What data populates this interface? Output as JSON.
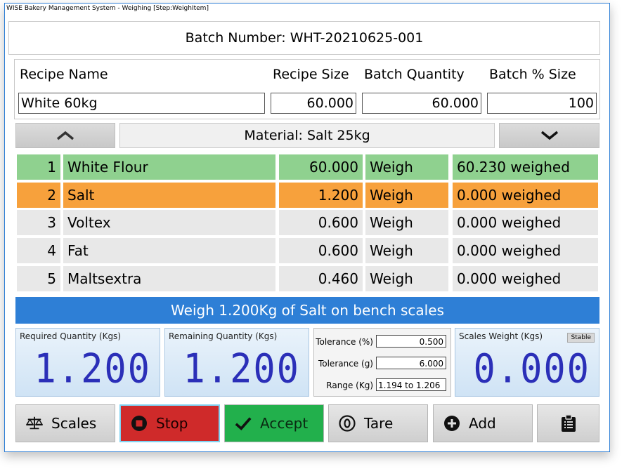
{
  "window": {
    "title": "WISE Bakery Management System - Weighing [Step:WeighItem]"
  },
  "batch": {
    "label": "Batch Number: WHT-20210625-001"
  },
  "recipe": {
    "name_label": "Recipe Name",
    "size_label": "Recipe Size",
    "quantity_label": "Batch Quantity",
    "percent_label": "Batch %  Size",
    "name_value": "White 60kg",
    "size_value": "60.000",
    "quantity_value": "60.000",
    "percent_value": "100"
  },
  "material": {
    "label": "Material: Salt 25kg"
  },
  "items": [
    {
      "num": "1",
      "name": "White Flour",
      "qty": "60.000",
      "action": "Weigh",
      "status": "60.230 weighed"
    },
    {
      "num": "2",
      "name": "Salt",
      "qty": "1.200",
      "action": "Weigh",
      "status": "0.000 weighed"
    },
    {
      "num": "3",
      "name": "Voltex",
      "qty": "0.600",
      "action": "Weigh",
      "status": "0.000 weighed"
    },
    {
      "num": "4",
      "name": "Fat",
      "qty": "0.600",
      "action": "Weigh",
      "status": "0.000 weighed"
    },
    {
      "num": "5",
      "name": "Maltsextra",
      "qty": "0.460",
      "action": "Weigh",
      "status": "0.000 weighed"
    }
  ],
  "instruction": "Weigh 1.200Kg of Salt on bench scales",
  "required": {
    "label": "Required Quantity (Kgs)",
    "value": "1.200"
  },
  "remaining": {
    "label": "Remaining Quantity (Kgs)",
    "value": "1.200"
  },
  "tolerance": {
    "pct_label": "Tolerance (%)",
    "pct_value": "0.500",
    "g_label": "Tolerance (g)",
    "g_value": "6.000",
    "range_label": "Range (Kg)",
    "range_value": "1.194 to 1.206"
  },
  "scales": {
    "label": "Scales Weight (Kgs)",
    "value": "0.000",
    "status": "Stable"
  },
  "buttons": {
    "scales": "Scales",
    "stop": "Stop",
    "accept": "Accept",
    "tare": "Tare",
    "add": "Add"
  },
  "colors": {
    "accent": "#2e7fd6",
    "done": "#8fd18f",
    "current": "#f7a13c",
    "stop": "#cf2a2a",
    "accept": "#22b04c",
    "digits": "#2b2fb8"
  },
  "icons": {
    "scales": "balance-scale-icon",
    "stop": "stop-circle-icon",
    "accept": "check-icon",
    "tare": "zero-circle-icon",
    "add": "plus-circle-icon",
    "clipboard": "clipboard-icon",
    "up": "chevron-up-icon",
    "down": "chevron-down-icon"
  }
}
